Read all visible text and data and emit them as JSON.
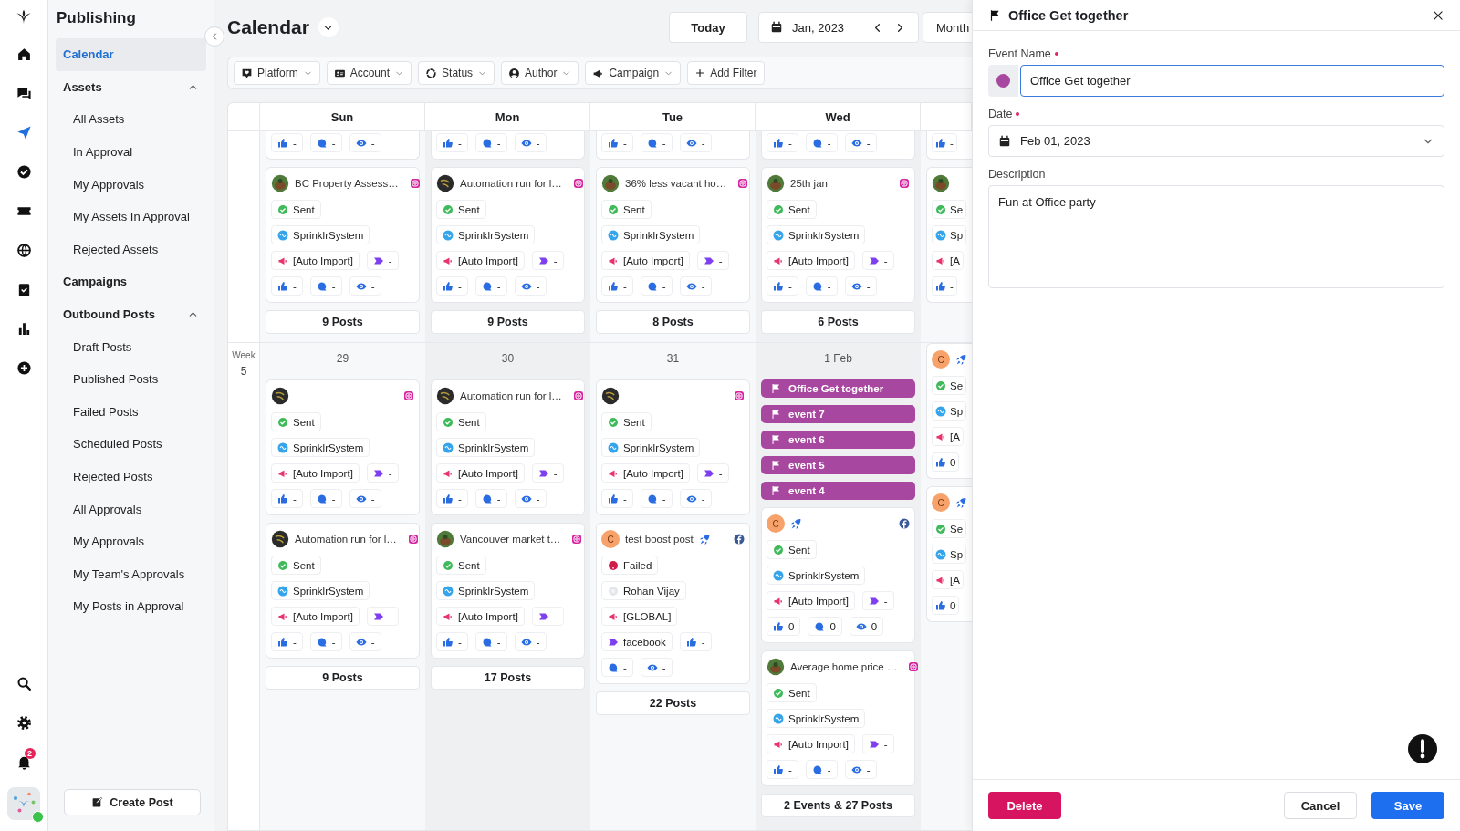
{
  "rail": {
    "top": [
      {
        "kind": "home",
        "selected": false
      },
      {
        "kind": "chat",
        "selected": false
      },
      {
        "kind": "send",
        "selected": true
      },
      {
        "kind": "check",
        "selected": false
      },
      {
        "kind": "ticket",
        "selected": false
      },
      {
        "kind": "globe",
        "selected": false
      },
      {
        "kind": "tasks",
        "selected": false
      },
      {
        "kind": "reports",
        "selected": false
      },
      {
        "kind": "add",
        "selected": false
      }
    ],
    "bottom": [
      {
        "kind": "search"
      },
      {
        "kind": "settings"
      },
      {
        "kind": "notifications",
        "badge": "2"
      }
    ],
    "profile": {
      "online": true
    }
  },
  "sidebar": {
    "title": "Publishing",
    "items": [
      {
        "label": "Calendar",
        "selected": true
      },
      {
        "label": "Assets",
        "selected": false,
        "expanded": true,
        "children": [
          {
            "label": "All Assets",
            "selected": false
          },
          {
            "label": "In Approval",
            "selected": false
          },
          {
            "label": "My Approvals",
            "selected": false
          },
          {
            "label": "My Assets In Approval",
            "selected": false
          },
          {
            "label": "Rejected Assets",
            "selected": false
          }
        ]
      },
      {
        "label": "Campaigns",
        "selected": false
      },
      {
        "label": "Outbound Posts",
        "selected": false,
        "expanded": true,
        "children": [
          {
            "label": "Draft Posts",
            "selected": false
          },
          {
            "label": "Published Posts",
            "selected": false
          },
          {
            "label": "Failed Posts",
            "selected": false
          },
          {
            "label": "Scheduled Posts",
            "selected": false
          },
          {
            "label": "Rejected Posts",
            "selected": false
          },
          {
            "label": "All Approvals",
            "selected": false
          },
          {
            "label": "My Approvals",
            "selected": false
          },
          {
            "label": "My Team's Approvals",
            "selected": false
          },
          {
            "label": "My Posts in Approval",
            "selected": false
          }
        ]
      }
    ],
    "create_button": "Create Post"
  },
  "header": {
    "title": "Calendar",
    "today": "Today",
    "date": "Jan, 2023",
    "view": "Month"
  },
  "filters": [
    {
      "kind": "platform",
      "label": "Platform"
    },
    {
      "kind": "account",
      "label": "Account"
    },
    {
      "kind": "status",
      "label": "Status"
    },
    {
      "kind": "author",
      "label": "Author"
    },
    {
      "kind": "campaign",
      "label": "Campaign"
    }
  ],
  "add_filter": "Add Filter",
  "calendar": {
    "days": [
      "Sun",
      "Mon",
      "Tue",
      "Wed"
    ],
    "weeks": [
      {
        "cells": [
          {
            "cards": [
              {
                "kind": "tail",
                "likes": "-",
                "comments": "-",
                "views": "-"
              },
              {
                "kind": "post",
                "avatar": {
                  "kind": "green"
                },
                "title": "BC Property Assess…",
                "boosted": false,
                "platform": {
                  "kind": "instagram"
                },
                "status": {
                  "kind": "sent",
                  "text": "Sent"
                },
                "account": {
                  "kind": "system",
                  "text": "SprinklrSystem"
                },
                "campaign": "[Auto Import]",
                "tag": "-",
                "likes": "-",
                "comments": "-",
                "views": "-"
              }
            ],
            "footer": "9 Posts"
          },
          {
            "cards": [
              {
                "kind": "tail",
                "likes": "-",
                "comments": "-",
                "views": "-"
              },
              {
                "kind": "post",
                "avatar": {
                  "kind": "dark"
                },
                "title": "Automation run for l…",
                "boosted": false,
                "platform": {
                  "kind": "instagram"
                },
                "status": {
                  "kind": "sent",
                  "text": "Sent"
                },
                "account": {
                  "kind": "system",
                  "text": "SprinklrSystem"
                },
                "campaign": "[Auto Import]",
                "tag": "-",
                "likes": "-",
                "comments": "-",
                "views": "-"
              }
            ],
            "footer": "9 Posts"
          },
          {
            "cards": [
              {
                "kind": "tail",
                "likes": "-",
                "comments": "-",
                "views": "-"
              },
              {
                "kind": "post",
                "avatar": {
                  "kind": "green"
                },
                "title": "36% less vacant ho…",
                "boosted": false,
                "platform": {
                  "kind": "instagram"
                },
                "status": {
                  "kind": "sent",
                  "text": "Sent"
                },
                "account": {
                  "kind": "system",
                  "text": "SprinklrSystem"
                },
                "campaign": "[Auto Import]",
                "tag": "-",
                "likes": "-",
                "comments": "-",
                "views": "-"
              }
            ],
            "footer": "8 Posts"
          },
          {
            "cards": [
              {
                "kind": "tail",
                "likes": "-",
                "comments": "-",
                "views": "-"
              },
              {
                "kind": "post",
                "avatar": {
                  "kind": "green"
                },
                "title": "25th jan",
                "boosted": false,
                "platform": {
                  "kind": "instagram"
                },
                "status": {
                  "kind": "sent",
                  "text": "Sent"
                },
                "account": {
                  "kind": "system",
                  "text": "SprinklrSystem"
                },
                "campaign": "[Auto Import]",
                "tag": "-",
                "likes": "-",
                "comments": "-",
                "views": "-"
              }
            ],
            "footer": "6 Posts"
          },
          {
            "cards": [
              {
                "kind": "tail",
                "likes": "-"
              },
              {
                "kind": "post",
                "avatar": {
                  "kind": "green"
                },
                "boosted": false,
                "status": {
                  "kind": "sent",
                  "text": "Se"
                },
                "account": {
                  "kind": "system",
                  "text": "Sp"
                },
                "campaign": "[A",
                "likes": "-"
              }
            ]
          }
        ]
      },
      {
        "label": "Week",
        "number": "5",
        "cells": [
          {
            "date": "29",
            "cards": [
              {
                "kind": "post",
                "avatar": {
                  "kind": "dark"
                },
                "boosted": false,
                "platform": {
                  "kind": "instagram"
                },
                "status": {
                  "kind": "sent",
                  "text": "Sent"
                },
                "account": {
                  "kind": "system",
                  "text": "SprinklrSystem"
                },
                "campaign": "[Auto Import]",
                "tag": "-",
                "likes": "-",
                "comments": "-",
                "views": "-"
              },
              {
                "kind": "post",
                "avatar": {
                  "kind": "dark"
                },
                "title": "Automation run for l…",
                "boosted": false,
                "platform": {
                  "kind": "instagram"
                },
                "status": {
                  "kind": "sent",
                  "text": "Sent"
                },
                "account": {
                  "kind": "system",
                  "text": "SprinklrSystem"
                },
                "campaign": "[Auto Import]",
                "tag": "-",
                "likes": "-",
                "comments": "-",
                "views": "-"
              }
            ],
            "footer": "9 Posts"
          },
          {
            "date": "30",
            "cards": [
              {
                "kind": "post",
                "avatar": {
                  "kind": "dark"
                },
                "title": "Automation run for l…",
                "boosted": false,
                "platform": {
                  "kind": "instagram"
                },
                "status": {
                  "kind": "sent",
                  "text": "Sent"
                },
                "account": {
                  "kind": "system",
                  "text": "SprinklrSystem"
                },
                "campaign": "[Auto Import]",
                "tag": "-",
                "likes": "-",
                "comments": "-",
                "views": "-"
              },
              {
                "kind": "post",
                "avatar": {
                  "kind": "green"
                },
                "title": "Vancouver market t…",
                "boosted": false,
                "platform": {
                  "kind": "instagram"
                },
                "status": {
                  "kind": "sent",
                  "text": "Sent"
                },
                "account": {
                  "kind": "system",
                  "text": "SprinklrSystem"
                },
                "campaign": "[Auto Import]",
                "tag": "-",
                "likes": "-",
                "comments": "-",
                "views": "-"
              }
            ],
            "footer": "17 Posts"
          },
          {
            "date": "31",
            "cards": [
              {
                "kind": "post",
                "avatar": {
                  "kind": "dark"
                },
                "boosted": false,
                "platform": {
                  "kind": "instagram"
                },
                "status": {
                  "kind": "sent",
                  "text": "Sent"
                },
                "account": {
                  "kind": "system",
                  "text": "SprinklrSystem"
                },
                "campaign": "[Auto Import]",
                "tag": "-",
                "likes": "-",
                "comments": "-",
                "views": "-"
              },
              {
                "kind": "post",
                "avatar": {
                  "kind": "letter",
                  "letter": "C"
                },
                "title": "test boost post",
                "boosted": true,
                "platform": {
                  "kind": "facebook"
                },
                "status": {
                  "kind": "failed",
                  "text": "Failed"
                },
                "account": {
                  "kind": "user",
                  "text": "Rohan Vijay"
                },
                "campaign": "[GLOBAL]",
                "tag": "facebook",
                "likes": "-",
                "comments": "-",
                "views": "-"
              }
            ],
            "footer": "22 Posts"
          },
          {
            "date": "1 Feb",
            "events": [
              {
                "label": "Office Get together",
                "color": "#a8479f"
              },
              {
                "label": "event 7",
                "color": "#a8479f"
              },
              {
                "label": "event 6",
                "color": "#a8479f"
              },
              {
                "label": "event 5",
                "color": "#a8479f"
              },
              {
                "label": "event 4",
                "color": "#a8479f"
              }
            ],
            "cards": [
              {
                "kind": "post",
                "avatar": {
                  "kind": "letter",
                  "letter": "C"
                },
                "boosted": true,
                "platform": {
                  "kind": "facebook"
                },
                "status": {
                  "kind": "sent",
                  "text": "Sent"
                },
                "account": {
                  "kind": "system",
                  "text": "SprinklrSystem"
                },
                "campaign": "[Auto Import]",
                "tag": "-",
                "likes": "0",
                "comments": "0",
                "views": "0"
              },
              {
                "kind": "post",
                "avatar": {
                  "kind": "green"
                },
                "title": "Average home price …",
                "boosted": false,
                "platform": {
                  "kind": "instagram"
                },
                "status": {
                  "kind": "sent",
                  "text": "Sent"
                },
                "account": {
                  "kind": "system",
                  "text": "SprinklrSystem"
                },
                "campaign": "[Auto Import]",
                "tag": "-",
                "likes": "-",
                "comments": "-",
                "views": "-"
              }
            ],
            "footer": "2 Events & 27 Posts"
          },
          {
            "cards": [
              {
                "kind": "post",
                "avatar": {
                  "kind": "letter",
                  "letter": "C"
                },
                "boosted": true,
                "status": {
                  "kind": "sent",
                  "text": "Se"
                },
                "account": {
                  "kind": "system",
                  "text": "Sp"
                },
                "campaign": "[A",
                "likes": "0"
              },
              {
                "kind": "post",
                "avatar": {
                  "kind": "letter",
                  "letter": "C"
                },
                "boosted": true,
                "status": {
                  "kind": "sent",
                  "text": "Se"
                },
                "account": {
                  "kind": "system",
                  "text": "Sp"
                },
                "campaign": "[A",
                "likes": "0"
              }
            ]
          }
        ]
      }
    ]
  },
  "panel": {
    "title": "Office Get together",
    "fields": [
      {
        "kind": "name",
        "label": "Event Name",
        "required": true,
        "value": "Office Get together",
        "color": "#a8479f"
      },
      {
        "kind": "date",
        "label": "Date",
        "required": true,
        "value": "Feb 01, 2023"
      },
      {
        "kind": "textarea",
        "label": "Description",
        "required": false,
        "value": "Fun at Office party"
      }
    ],
    "delete": "Delete",
    "cancel": "Cancel",
    "save": "Save"
  }
}
